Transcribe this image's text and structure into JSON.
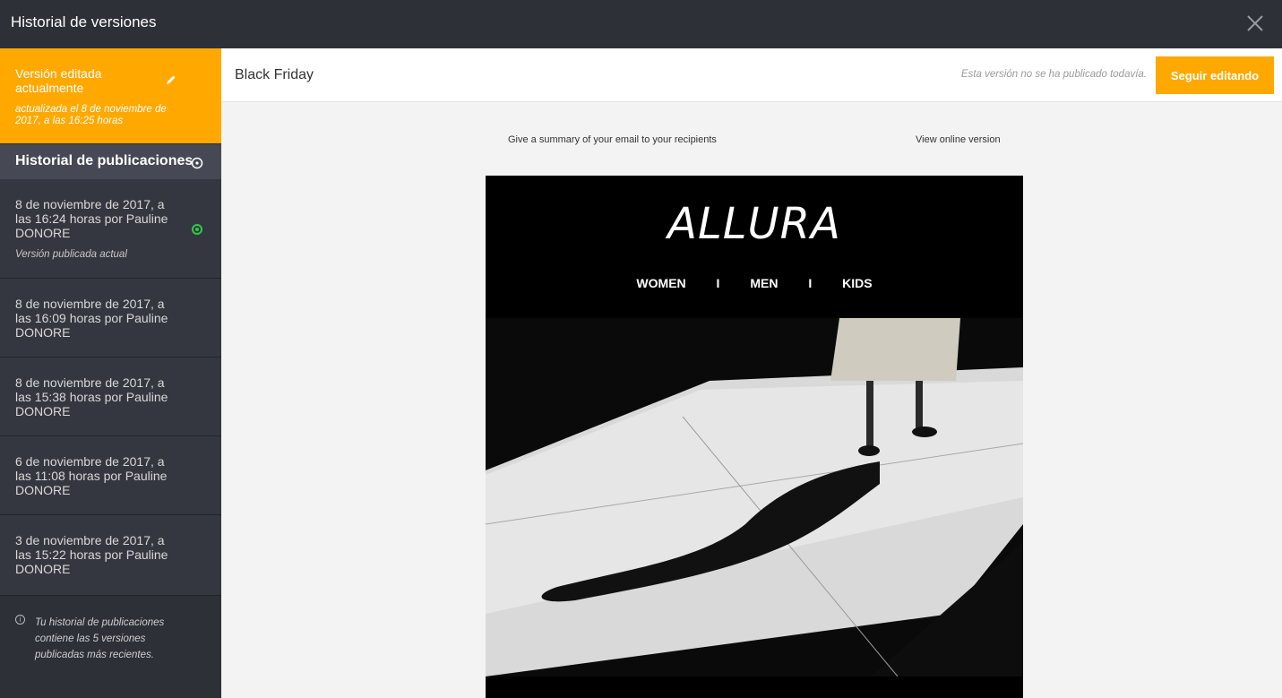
{
  "window": {
    "title": "Historial de versiones"
  },
  "current_version": {
    "label": "Versión editada actualmente",
    "updated": "actualizada el 8 de noviembre de 2017, a las 16:25 horas"
  },
  "history": {
    "header": "Historial de publicaciones",
    "items": [
      {
        "text": "8 de noviembre de 2017, a las 16:24 horas por Pauline DONORE",
        "sub": "Versión publicada actual"
      },
      {
        "text": "8 de noviembre de 2017, a las 16:09 horas por Pauline DONORE"
      },
      {
        "text": "8 de noviembre de 2017, a las 15:38 horas por Pauline DONORE"
      },
      {
        "text": "6 de noviembre de 2017, a las 11:08 horas por Pauline DONORE"
      },
      {
        "text": "3 de noviembre de 2017, a las 15:22 horas por Pauline DONORE"
      }
    ],
    "note": "Tu historial de publicaciones contiene las 5 versiones publicadas más recientes."
  },
  "document": {
    "name": "Black Friday",
    "status": "Esta versión no se ha publicado todavía.",
    "button": "Seguir editando"
  },
  "email": {
    "preheader_left": "Give a summary of your email to your recipients",
    "preheader_right": "View online version",
    "logo": "ALLURA",
    "nav": [
      "WOMEN",
      "I",
      "MEN",
      "I",
      "KIDS"
    ]
  },
  "colors": {
    "accent": "#ffa800",
    "sidebar": "#2e3038",
    "published": "#2ecc40"
  },
  "icons": [
    "close-icon",
    "pencil-icon",
    "clock-icon",
    "published-dot-icon",
    "info-icon"
  ]
}
